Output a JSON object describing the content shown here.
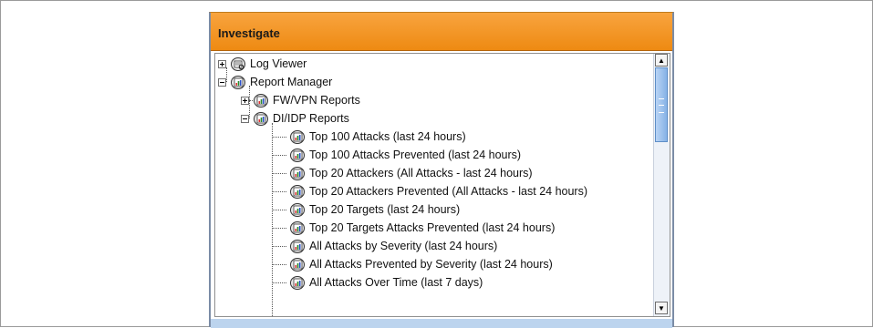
{
  "panel": {
    "title": "Investigate"
  },
  "tree": {
    "log_viewer": "Log Viewer",
    "report_manager": "Report Manager",
    "fw_vpn_reports": "FW/VPN Reports",
    "di_idp_reports": "DI/IDP Reports",
    "reports": [
      "Top 100 Attacks (last 24 hours)",
      "Top 100 Attacks Prevented (last 24 hours)",
      "Top 20 Attackers (All Attacks - last 24 hours)",
      "Top 20 Attackers Prevented (All Attacks - last 24 hours)",
      "Top 20 Targets (last 24 hours)",
      "Top 20 Targets Attacks Prevented (last 24 hours)",
      "All Attacks by Severity (last 24 hours)",
      "All Attacks Prevented by Severity (last 24 hours)",
      "All Attacks Over Time (last 7 days)"
    ]
  },
  "scrollbar": {
    "up_arrow": "▲",
    "down_arrow": "▼"
  },
  "colors": {
    "header": "#f39a28",
    "scroll_thumb": "#8fb8ea"
  }
}
